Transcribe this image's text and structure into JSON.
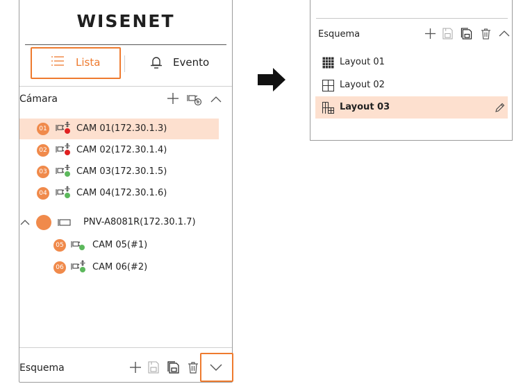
{
  "brand": {
    "logo_text": "WISENET"
  },
  "tabs": [
    {
      "label": "Lista",
      "icon": "list-icon",
      "active": true
    },
    {
      "label": "Evento",
      "icon": "bell-icon",
      "active": false
    }
  ],
  "camera_section": {
    "title": "Cámara",
    "actions": [
      "add-icon",
      "add-group-icon",
      "chevron-up-icon"
    ]
  },
  "cameras": [
    {
      "badge": "01",
      "label": "CAM 01(172.30.1.3)",
      "status": "red",
      "selected": true
    },
    {
      "badge": "02",
      "label": "CAM 02(172.30.1.4)",
      "status": "red",
      "selected": false
    },
    {
      "badge": "03",
      "label": "CAM 03(172.30.1.5)",
      "status": "green",
      "selected": false
    },
    {
      "badge": "04",
      "label": "CAM 04(172.30.1.6)",
      "status": "green",
      "selected": false
    }
  ],
  "nvr_group": {
    "label": "PNV-A8081R(172.30.1.7)",
    "expanded": true,
    "children": [
      {
        "badge": "05",
        "label": "CAM 05(#1)",
        "status": "green"
      },
      {
        "badge": "06",
        "label": "CAM 06(#2)",
        "status": "green"
      }
    ]
  },
  "schema_left": {
    "title": "Esquema"
  },
  "schema_right": {
    "title": "Esquema",
    "layouts": [
      {
        "label": "Layout 01",
        "icon": "grid-16-icon",
        "selected": false
      },
      {
        "label": "Layout 02",
        "icon": "grid-4-icon",
        "selected": false
      },
      {
        "label": "Layout 03",
        "icon": "grid-custom-icon",
        "selected": true
      }
    ]
  },
  "colors": {
    "accent": "#ee7a2e",
    "badge": "#f08a4b",
    "selection": "#fde0cf",
    "status_red": "#e02020",
    "status_green": "#5cb85c"
  }
}
